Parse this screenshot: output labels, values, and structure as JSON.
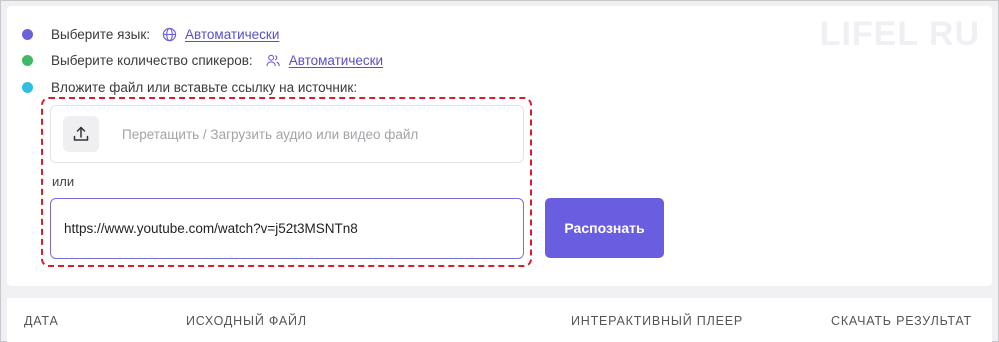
{
  "watermark": "LIFEL  RU",
  "steps": [
    {
      "label": "Выберите язык:",
      "value": "Автоматически",
      "icon": "globe-icon",
      "color": "#6b62d8"
    },
    {
      "label": "Выберите количество спикеров:",
      "value": "Автоматически",
      "icon": "users-icon",
      "color": "#3fb968"
    },
    {
      "label": "Вложите файл или вставьте ссылку на источник:",
      "color": "#2ec0e0"
    }
  ],
  "upload": {
    "icon": "upload-icon",
    "text": "Перетащить / Загрузить аудио или видео файл"
  },
  "or_label": "или",
  "url_input": {
    "value": "https://www.youtube.com/watch?v=j52t3MSNTn8"
  },
  "submit_label": "Распознать",
  "table": {
    "columns": [
      "ДАТА",
      "ИСХОДНЫЙ ФАЙЛ",
      "ИНТЕРАКТИВНЫЙ ПЛЕЕР",
      "СКАЧАТЬ РЕЗУЛЬТАТ"
    ]
  },
  "colors": {
    "accent": "#6a5ee0",
    "highlight": "#d81e2c",
    "link": "#5a4fc7"
  }
}
